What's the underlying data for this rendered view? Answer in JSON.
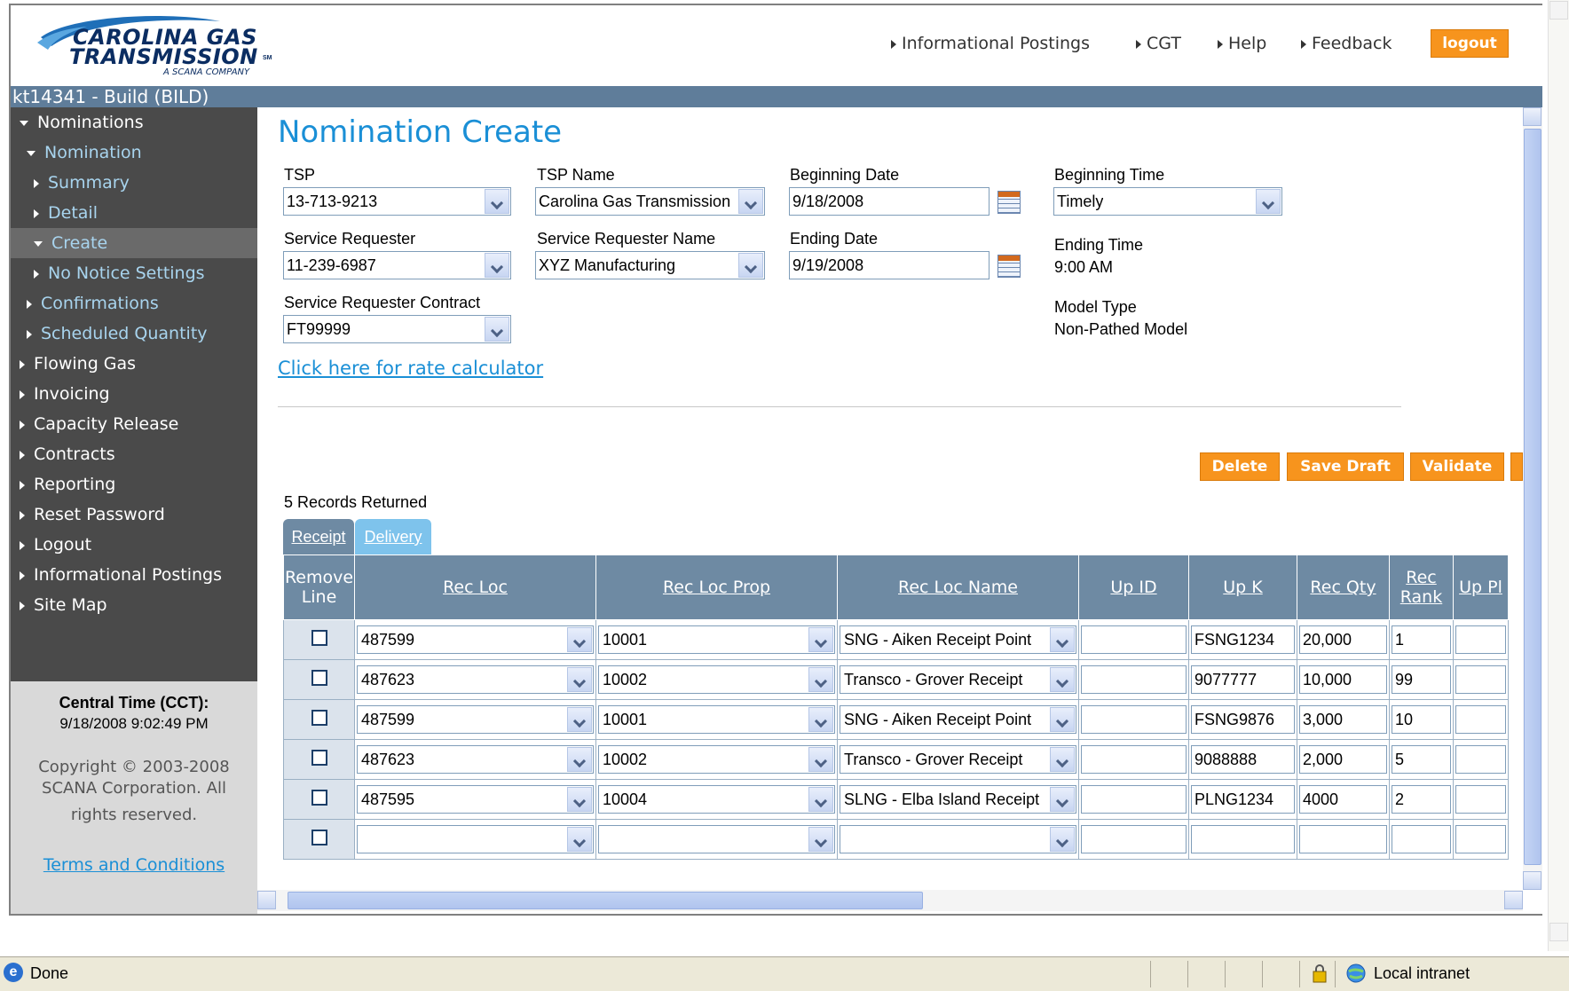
{
  "brand": {
    "line1": "CAROLINA GAS",
    "line2": "TRANSMISSION",
    "sm": "SM",
    "tagline": "A SCANA COMPANY"
  },
  "topnav": {
    "items": [
      "Informational Postings",
      "CGT",
      "Help",
      "Feedback"
    ],
    "logout": "logout"
  },
  "userbar": "kt14341 - Build (BILD)",
  "sidebar": {
    "items": [
      "Nominations",
      "Nomination",
      "Summary",
      "Detail",
      "Create",
      "No Notice Settings",
      "Confirmations",
      "Scheduled Quantity",
      "Flowing Gas",
      "Invoicing",
      "Capacity Release",
      "Contracts",
      "Reporting",
      "Reset Password",
      "Logout",
      "Informational Postings",
      "Site Map"
    ],
    "time_label": "Central Time (CCT):",
    "time_value": "9/18/2008 9:02:49 PM",
    "copyright_1": "Copyright © 2003-2008",
    "copyright_2": "SCANA Corporation. All",
    "copyright_3": "rights reserved.",
    "terms": "Terms and Conditions"
  },
  "page": {
    "title": "Nomination Create",
    "tsp_label": "TSP",
    "tsp_value": "13-713-9213",
    "tsp_name_label": "TSP Name",
    "tsp_name_value": "Carolina Gas Transmission",
    "beg_date_label": "Beginning Date",
    "beg_date_value": "9/18/2008",
    "beg_time_label": "Beginning Time",
    "beg_time_value": "Timely",
    "sr_label": "Service Requester",
    "sr_value": "11-239-6987",
    "sr_name_label": "Service Requester Name",
    "sr_name_value": "XYZ Manufacturing",
    "end_date_label": "Ending Date",
    "end_date_value": "9/19/2008",
    "end_time_label": "Ending Time",
    "end_time_value": "9:00 AM",
    "contract_label": "Service Requester Contract",
    "contract_value": "FT99999",
    "model_type_label": "Model Type",
    "model_type_value": "Non-Pathed Model",
    "rate_calc_link": "Click here for rate calculator",
    "actions": [
      "Delete",
      "Save Draft",
      "Validate"
    ],
    "records_returned": "5 Records Returned",
    "tabs": [
      "Receipt",
      "Delivery"
    ]
  },
  "grid": {
    "headers": [
      "Remove Line",
      "Rec Loc",
      "Rec Loc Prop",
      "Rec Loc Name",
      "Up ID",
      "Up K",
      "Rec Qty",
      "Rec Rank",
      "Up Pl"
    ],
    "rows": [
      {
        "rec_loc": "487599",
        "prop": "10001",
        "name": "SNG - Aiken Receipt Point",
        "up_id": "",
        "up_k": "FSNG1234",
        "qty": "20,000",
        "rank": "1"
      },
      {
        "rec_loc": "487623",
        "prop": "10002",
        "name": "Transco - Grover Receipt",
        "up_id": "",
        "up_k": "9077777",
        "qty": "10,000",
        "rank": "99"
      },
      {
        "rec_loc": "487599",
        "prop": "10001",
        "name": "SNG - Aiken Receipt Point",
        "up_id": "",
        "up_k": "FSNG9876",
        "qty": "3,000",
        "rank": "10"
      },
      {
        "rec_loc": "487623",
        "prop": "10002",
        "name": "Transco - Grover Receipt",
        "up_id": "",
        "up_k": "9088888",
        "qty": "2,000",
        "rank": "5"
      },
      {
        "rec_loc": "487595",
        "prop": "10004",
        "name": "SLNG - Elba Island Receipt",
        "up_id": "",
        "up_k": "PLNG1234",
        "qty": "4000",
        "rank": "2"
      },
      {
        "rec_loc": "",
        "prop": "",
        "name": "",
        "up_id": "",
        "up_k": "",
        "qty": "",
        "rank": ""
      }
    ]
  },
  "status": {
    "left": "Done",
    "zone": "Local intranet"
  },
  "colors": {
    "accent_orange": "#f7941d",
    "header_blue": "#5f7d9a",
    "sidebar_gray": "#4a4a4a",
    "title_blue": "#1a8fd6"
  }
}
